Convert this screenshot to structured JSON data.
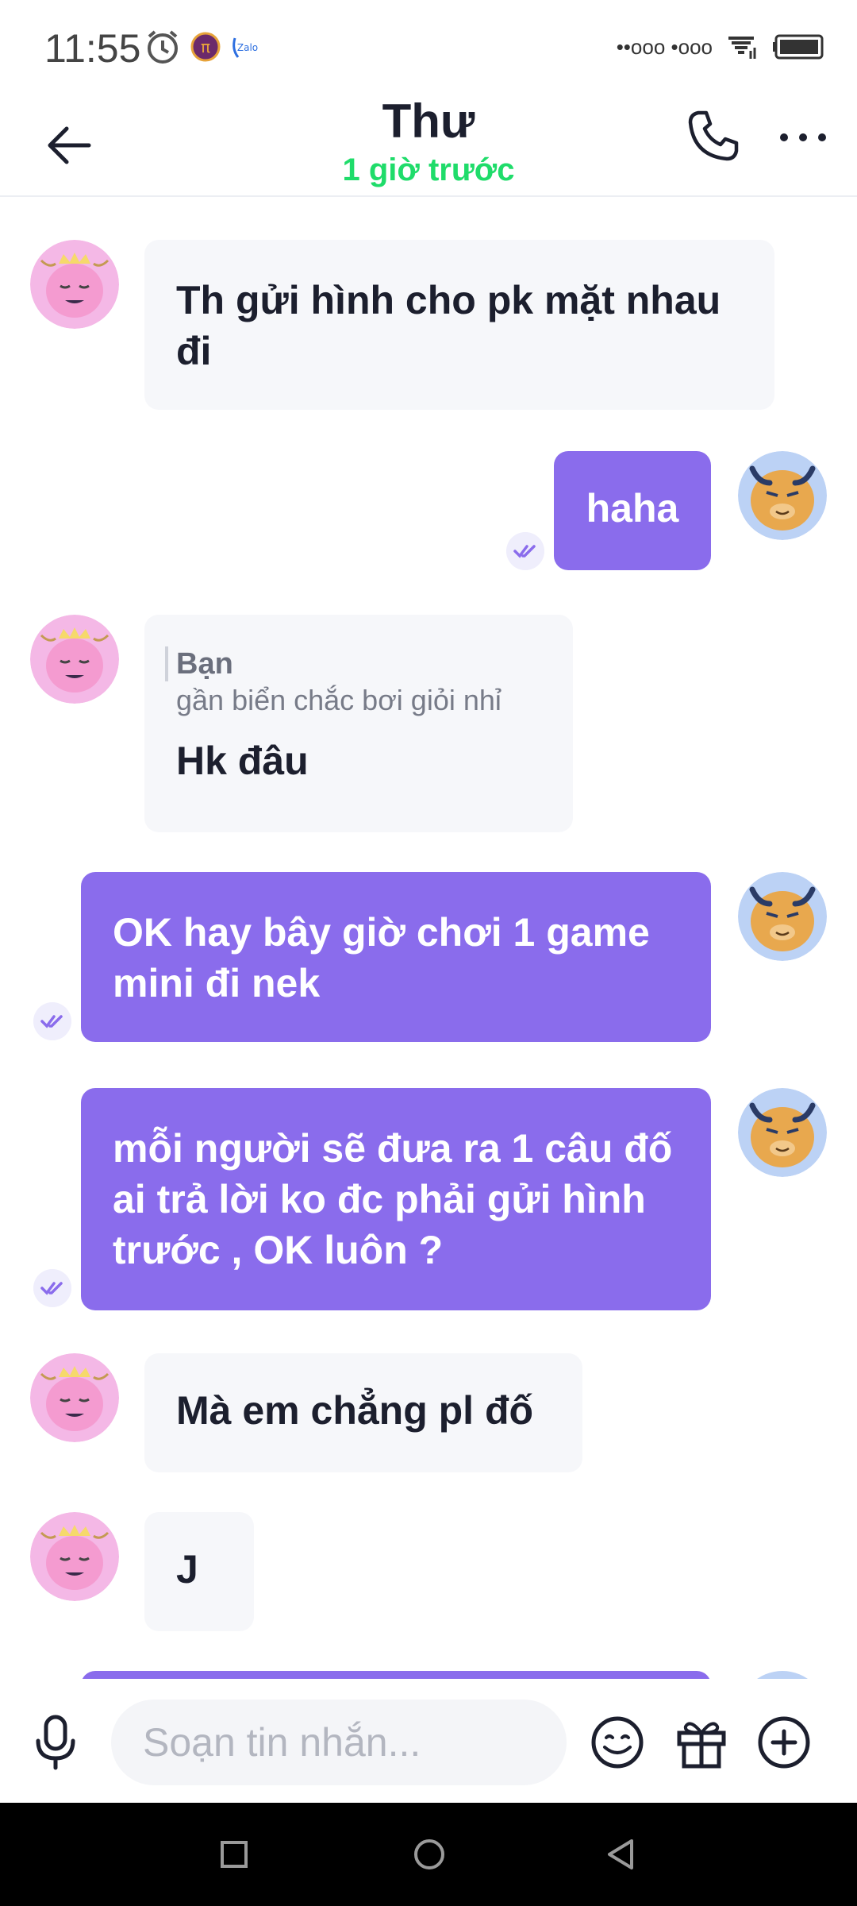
{
  "status_bar": {
    "time": "11:55",
    "signal_text": "••ooo  •ooo"
  },
  "header": {
    "title": "Thư",
    "subtitle": "1 giờ trước"
  },
  "messages": [
    {
      "sender": "them",
      "text": "Th gửi hình cho pk mặt nhau đi"
    },
    {
      "sender": "me",
      "text": "haha"
    },
    {
      "sender": "them",
      "reply_to_name": "Bạn",
      "reply_to_text": "gần biển chắc bơi giỏi nhỉ",
      "text": "Hk đâu"
    },
    {
      "sender": "me",
      "text": "OK hay bây giờ chơi 1 game mini đi nek"
    },
    {
      "sender": "me",
      "text": "mỗi người sẽ đưa ra 1 câu đố ai trả lời ko đc phải gửi hình trước , OK luôn ?"
    },
    {
      "sender": "them",
      "text": "Mà em chẳng pl đố"
    },
    {
      "sender": "them",
      "text": "J"
    }
  ],
  "composer": {
    "placeholder": "Soạn tin nhắn..."
  },
  "colors": {
    "outgoing_bubble": "#8a6cec",
    "incoming_bubble": "#f6f7fa",
    "online_status": "#1fdc6a"
  },
  "icons": [
    "back-arrow-icon",
    "phone-icon",
    "more-icon",
    "microphone-icon",
    "emoji-icon",
    "gift-icon",
    "plus-icon",
    "alarm-icon",
    "pi-app-icon",
    "zalo-icon",
    "wifi-icon",
    "battery-icon",
    "seen-check-icon"
  ]
}
